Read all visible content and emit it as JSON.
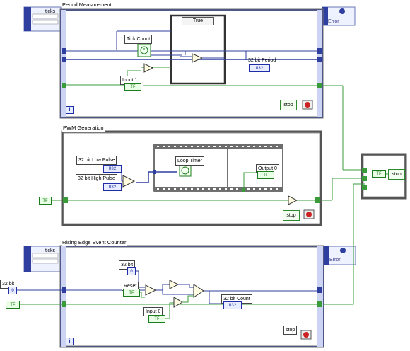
{
  "period_measurement": {
    "title": "Period Measurement",
    "ticks_label": "ticks",
    "case_selector": "True",
    "tick_count_label": "Tick Count",
    "period_indicator_label": "32 bit Period",
    "period_indicator_type": "U32",
    "input_label": "Input 1",
    "input_type": "TF",
    "stop_label": "stop",
    "error_label": "Error",
    "iteration": "i"
  },
  "pwm_generation": {
    "title": "PWM Generation",
    "low_pulse_label": "32 bit Low Pulse",
    "low_pulse_type": "U32",
    "high_pulse_label": "32 bit High Pulse",
    "high_pulse_type": "U32",
    "loop_timer_label": "Loop Timer",
    "output_label": "Output 0",
    "output_type": "TF",
    "stop_label": "stop",
    "bool_const": "TF"
  },
  "stop_terminal": {
    "bool_type": "TF",
    "stop_label": "stop"
  },
  "rising_edge_counter": {
    "title": "Rising Edge Event Counter",
    "ticks_label": "ticks",
    "error_label": "Error",
    "const_32bit_label": "32 bit",
    "const_32bit_value": "0",
    "reset_label": "Reset",
    "reset_type": "TF",
    "count_label": "32 bit Count",
    "count_type": "U32",
    "input_label": "Input 0",
    "input_type": "TF",
    "stop_label": "stop",
    "iteration": "i"
  },
  "external_inputs": {
    "bit32_label": "32 bit",
    "bit32_value": "0",
    "bool_type": "TF"
  }
}
